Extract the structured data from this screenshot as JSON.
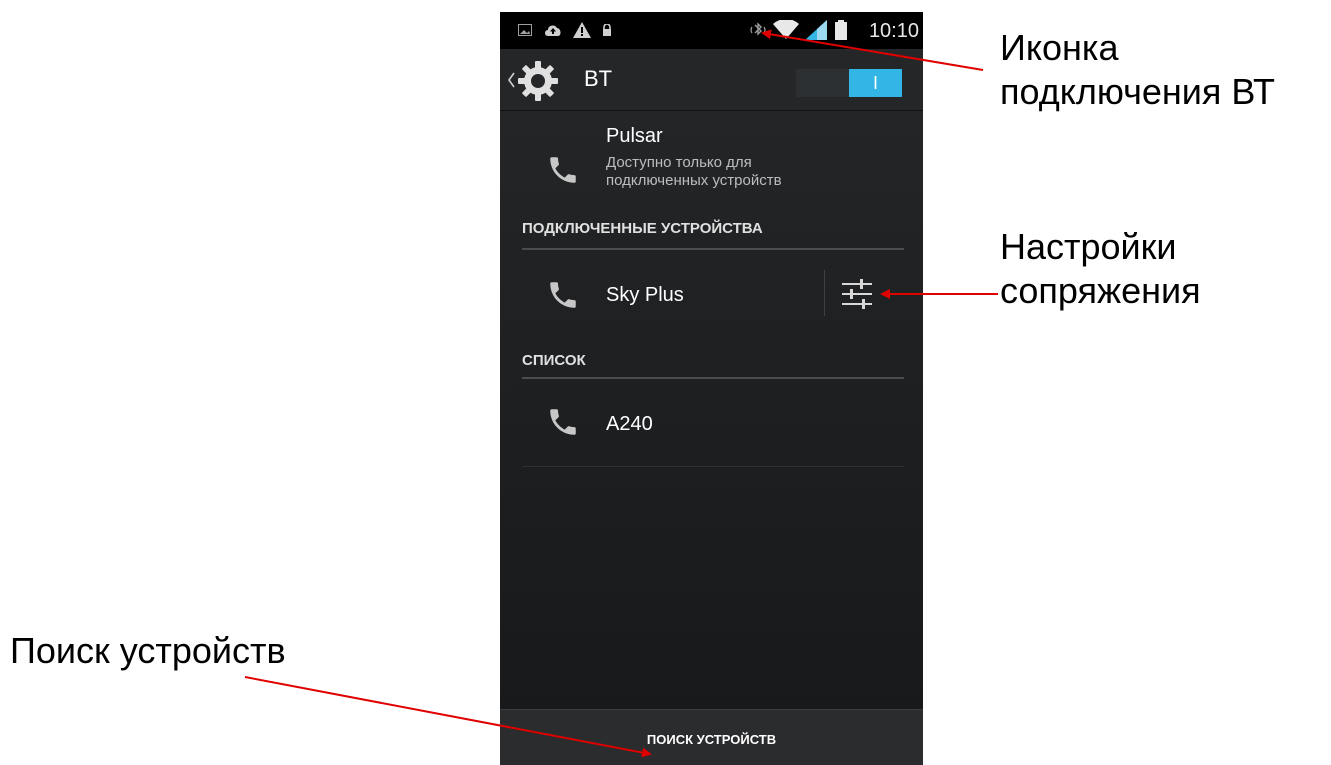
{
  "status_bar": {
    "time": "10:10",
    "left_icons": [
      "image-icon",
      "cloud-upload-icon",
      "warning-icon",
      "lock-icon"
    ],
    "right_icons": [
      "bluetooth-connected-icon",
      "wifi-icon",
      "signal-icon",
      "battery-icon"
    ]
  },
  "action_bar": {
    "title": "BT",
    "toggle_label": "I",
    "toggle_state": "on",
    "accent_color": "#33b5e5"
  },
  "this_device": {
    "name": "Pulsar",
    "subtitle": "Доступно только для\nподключенных устройств"
  },
  "sections": {
    "paired_header": "ПОДКЛЮЧЕННЫЕ УСТРОЙСТВА",
    "list_header": "СПИСОК"
  },
  "paired_devices": [
    {
      "name": "Sky Plus"
    }
  ],
  "available_devices": [
    {
      "name": "A240"
    }
  ],
  "bottom_bar": {
    "label": "ПОИСК УСТРОЙСТВ"
  },
  "annotations": {
    "bt_icon": "Иконка\nподключения ВТ",
    "pairing_settings": "Настройки\nсопряжения",
    "search": "Поиск устройств",
    "arrow_color": "#e00000"
  }
}
